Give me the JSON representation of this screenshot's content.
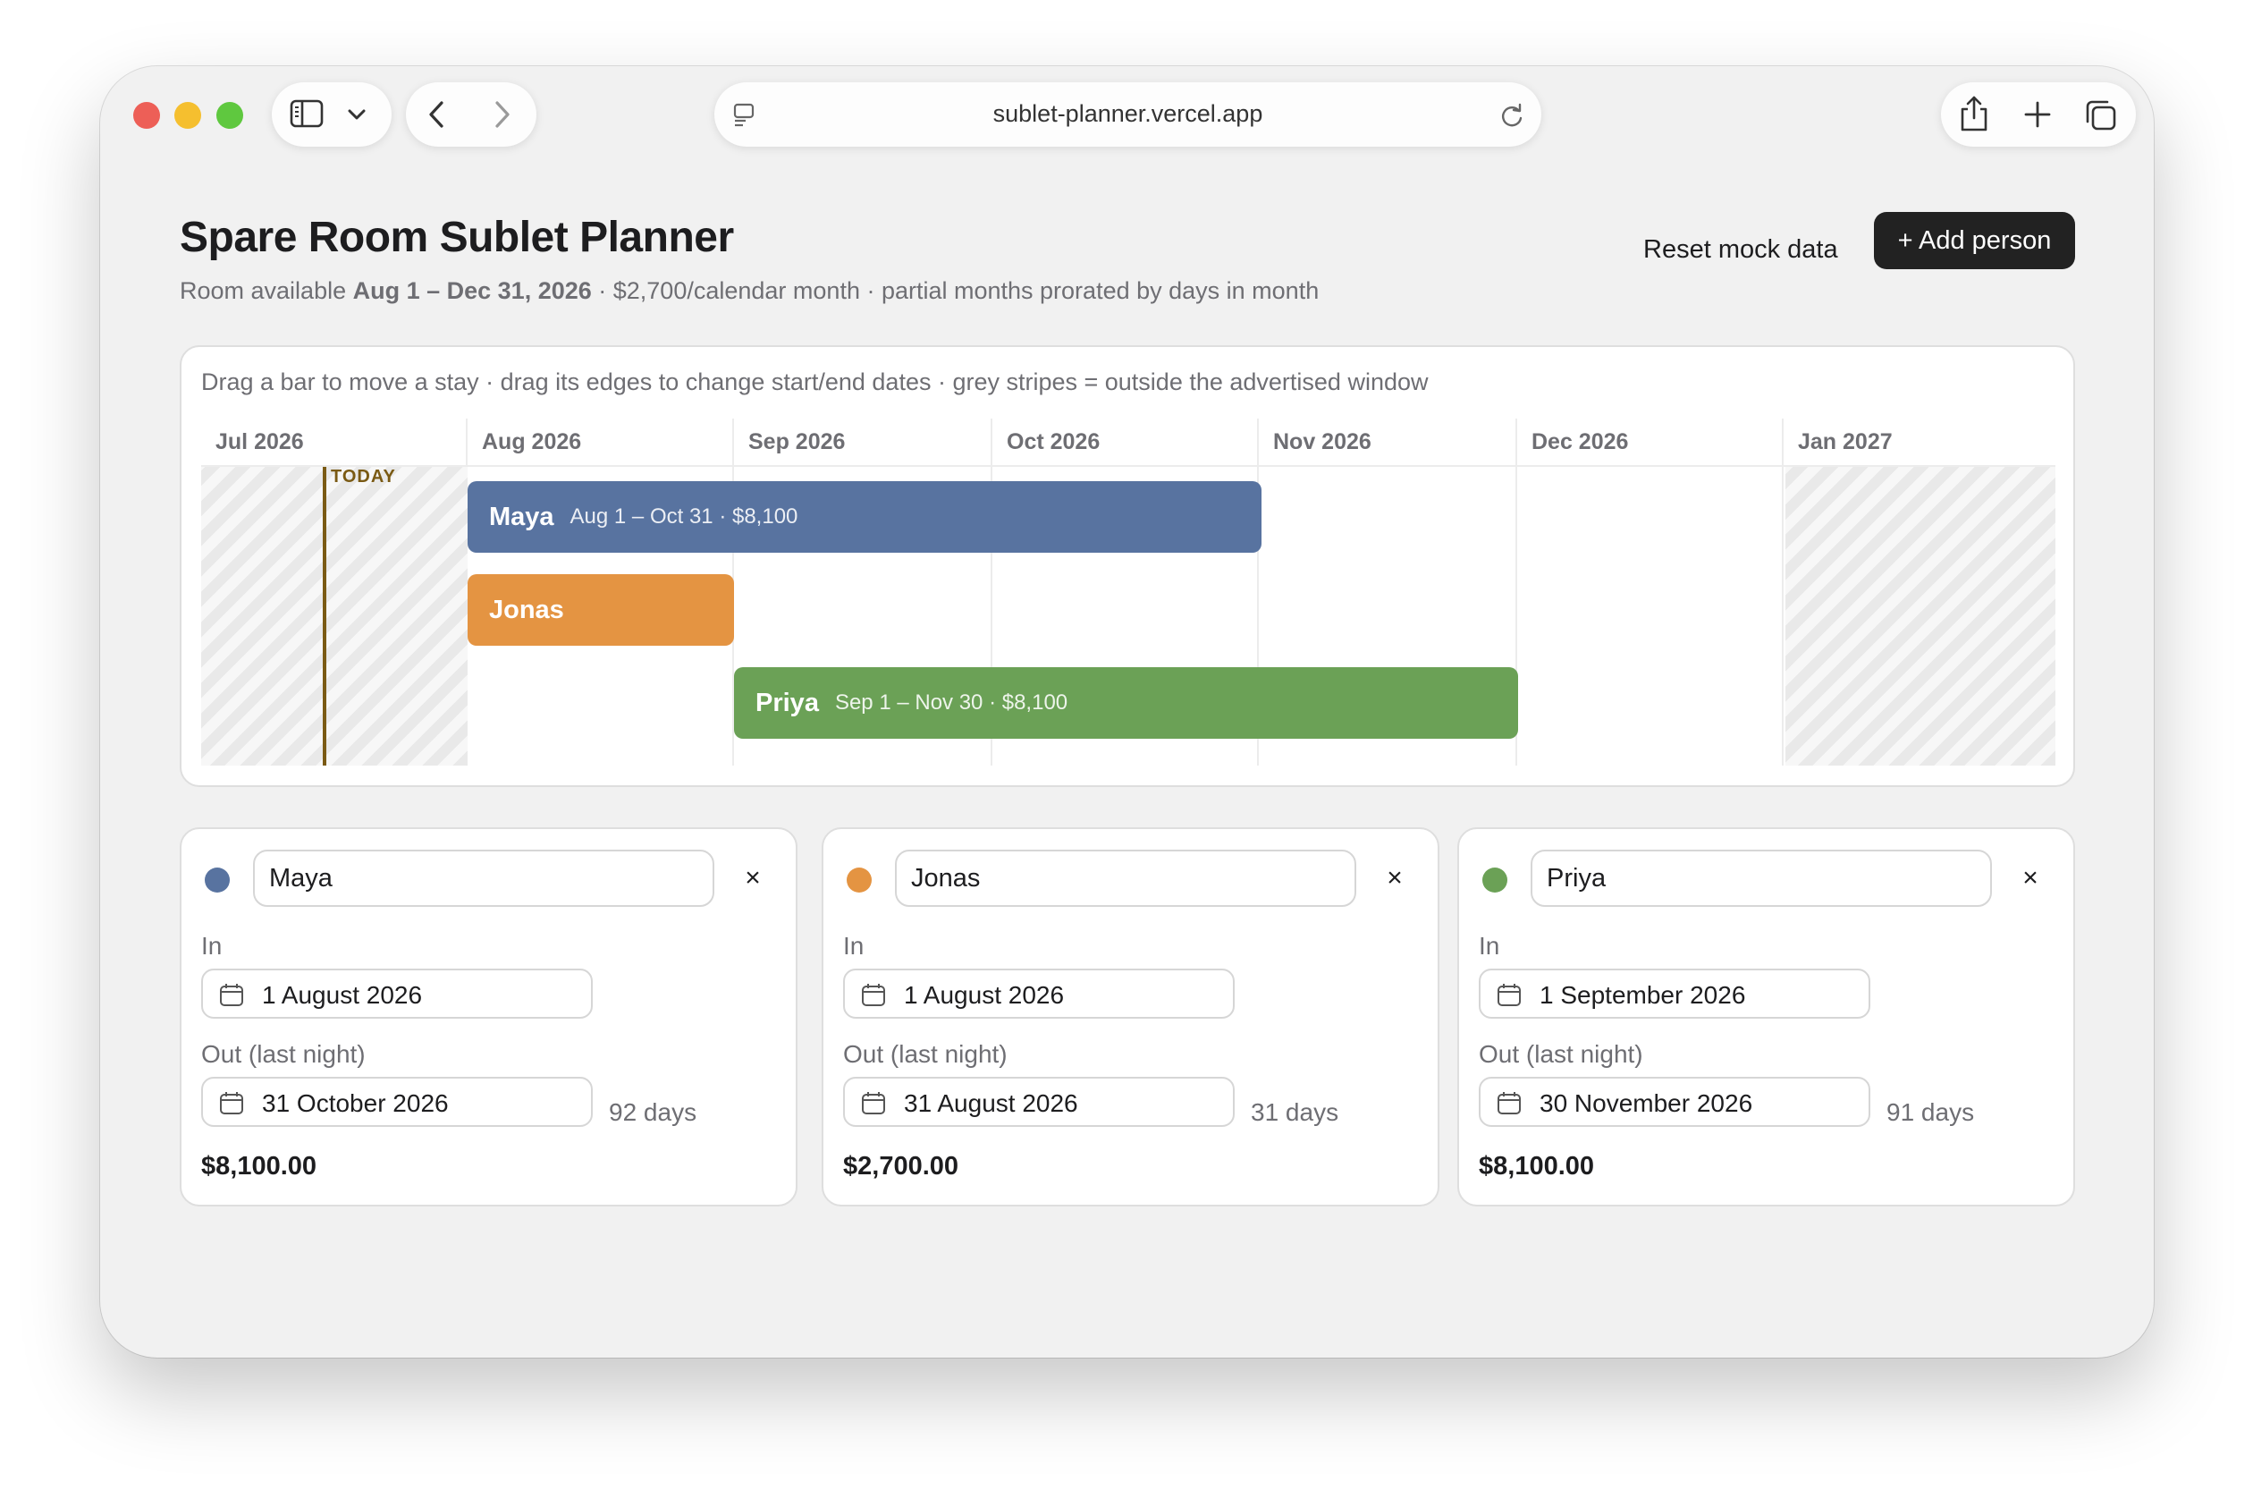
{
  "browser": {
    "url": "sublet-planner.vercel.app",
    "icons": [
      "sidebar-icon",
      "chevron-down-icon",
      "back-icon",
      "forward-icon",
      "page-menu-icon",
      "reload-icon",
      "share-icon",
      "new-tab-icon",
      "tabs-overview-icon"
    ]
  },
  "header": {
    "title": "Spare Room Sublet Planner",
    "subtitle_prefix": "Room available ",
    "subtitle_range": "Aug 1 – Dec 31, 2026",
    "subtitle_suffix": " · $2,700/calendar month · partial months prorated by days in month",
    "reset_label": "Reset mock data",
    "add_label": "+ Add person"
  },
  "timeline": {
    "hint": "Drag a bar to move a stay · drag its edges to change start/end dates · grey stripes = outside the advertised window",
    "months": [
      "Jul 2026",
      "Aug 2026",
      "Sep 2026",
      "Oct 2026",
      "Nov 2026",
      "Dec 2026",
      "Jan 2027"
    ],
    "today_label": "TODAY",
    "bars": [
      {
        "name": "Maya",
        "info": "Aug 1 – Oct 31 · $8,100",
        "color": "#5873a0"
      },
      {
        "name": "Jonas",
        "info": "",
        "color": "#e49442"
      },
      {
        "name": "Priya",
        "info": "Sep 1 – Nov 30 · $8,100",
        "color": "#6ba156"
      }
    ]
  },
  "people": [
    {
      "name": "Maya",
      "color": "#5873a0",
      "in_label": "In",
      "in_date": "1 August 2026",
      "out_label": "Out (last night)",
      "out_date": "31 October 2026",
      "days": "92 days",
      "cost": "$8,100.00"
    },
    {
      "name": "Jonas",
      "color": "#e49442",
      "in_label": "In",
      "in_date": "1 August 2026",
      "out_label": "Out (last night)",
      "out_date": "31 August 2026",
      "days": "31 days",
      "cost": "$2,700.00"
    },
    {
      "name": "Priya",
      "color": "#6ba156",
      "in_label": "In",
      "in_date": "1 September 2026",
      "out_label": "Out (last night)",
      "out_date": "30 November 2026",
      "days": "91 days",
      "cost": "$8,100.00"
    }
  ],
  "close_glyph": "×"
}
